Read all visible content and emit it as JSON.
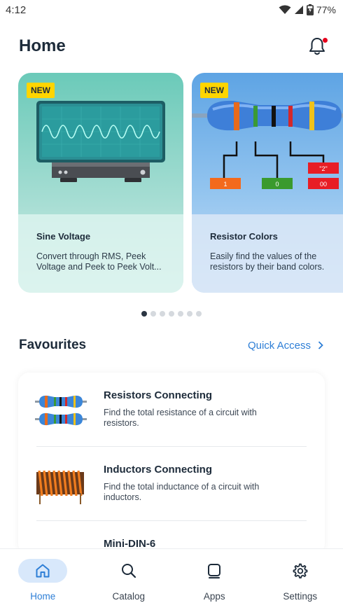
{
  "status_bar": {
    "time": "4:12",
    "battery": "77%"
  },
  "header": {
    "title": "Home"
  },
  "carousel": {
    "cards": [
      {
        "badge": "NEW",
        "title": "Sine Voltage",
        "description": "Convert through RMS, Peek Voltage and Peek to Peek Volt..."
      },
      {
        "badge": "NEW",
        "title": "Resistor Colors",
        "description": "Easily find the values of the resistors by their band colors.",
        "illustration_labels": {
          "first": "1",
          "second": "0",
          "third": "\"2\"",
          "multiplier": "00"
        }
      }
    ],
    "page_count": 7,
    "active_page": 1
  },
  "favourites": {
    "title": "Favourites",
    "quick_access_label": "Quick Access",
    "items": [
      {
        "name": "Resistors Connecting",
        "description": "Find the total resistance of a circuit with resistors."
      },
      {
        "name": "Inductors Connecting",
        "description": "Find the total inductance of a circuit with inductors."
      },
      {
        "name": "Mini-DIN-6",
        "description": ""
      }
    ]
  },
  "bottom_nav": {
    "items": [
      {
        "label": "Home",
        "icon": "home-icon",
        "active": true
      },
      {
        "label": "Catalog",
        "icon": "search-icon",
        "active": false
      },
      {
        "label": "Apps",
        "icon": "apps-icon",
        "active": false
      },
      {
        "label": "Settings",
        "icon": "gear-icon",
        "active": false
      }
    ]
  },
  "colors": {
    "accent": "#2d7ed6",
    "badge": "#ffd500",
    "notification": "#e6001c"
  }
}
